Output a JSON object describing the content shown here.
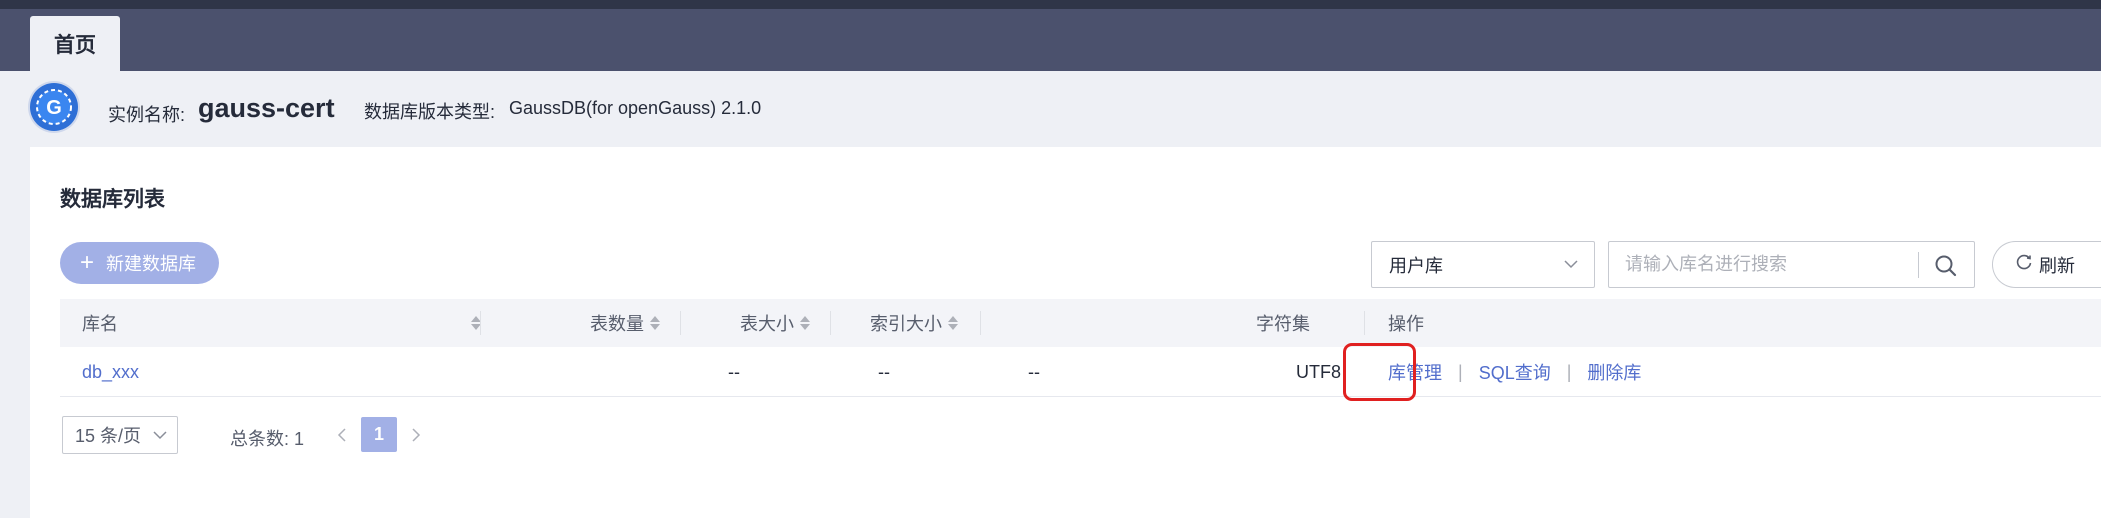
{
  "tabs": {
    "home": "首页"
  },
  "instance": {
    "name_label": "实例名称:",
    "name": "gauss-cert",
    "version_label": "数据库版本类型:",
    "version": "GaussDB(for openGauss) 2.1.0",
    "logo_letter": "G"
  },
  "panel": {
    "title": "数据库列表",
    "create_button": "新建数据库",
    "db_type_select": "用户库",
    "search_placeholder": "请输入库名进行搜索",
    "refresh_button": "刷新"
  },
  "table": {
    "headers": {
      "name": "库名",
      "table_count": "表数量",
      "table_size": "表大小",
      "index_size": "索引大小",
      "charset": "字符集",
      "ops": "操作"
    },
    "rows": [
      {
        "name": "db_xxx",
        "table_count": "--",
        "table_size": "--",
        "index_size": "--",
        "charset": "UTF8",
        "ops": {
          "manage": "库管理",
          "sql": "SQL查询",
          "delete": "删除库"
        }
      }
    ]
  },
  "pagination": {
    "page_size": "15 条/页",
    "total_label": "总条数:",
    "total": "1",
    "current_page": "1"
  },
  "colors": {
    "accent": "#526ecc",
    "highlight": "#e02020",
    "header_bg": "#4b516d"
  }
}
